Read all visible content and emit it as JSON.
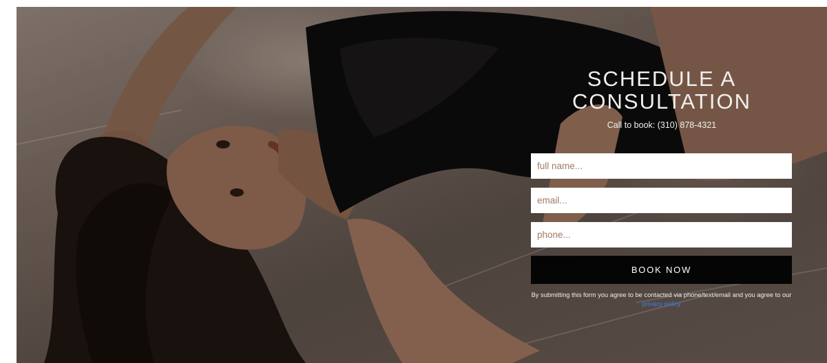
{
  "form": {
    "title_line1": "SCHEDULE A",
    "title_line2": "CONSULTATION",
    "call_text": "Call to book: (310) 878-4321",
    "name_placeholder": "full name...",
    "email_placeholder": "email...",
    "phone_placeholder": "phone...",
    "submit_label": "BOOK NOW",
    "disclaimer_text": "By submitting this form you agree to be contacted via phone/text/email and you agree to our",
    "privacy_link_text": "privacy policy"
  },
  "colors": {
    "button_bg": "#050505",
    "link": "#3b7cf0",
    "placeholder": "#a07a66"
  }
}
